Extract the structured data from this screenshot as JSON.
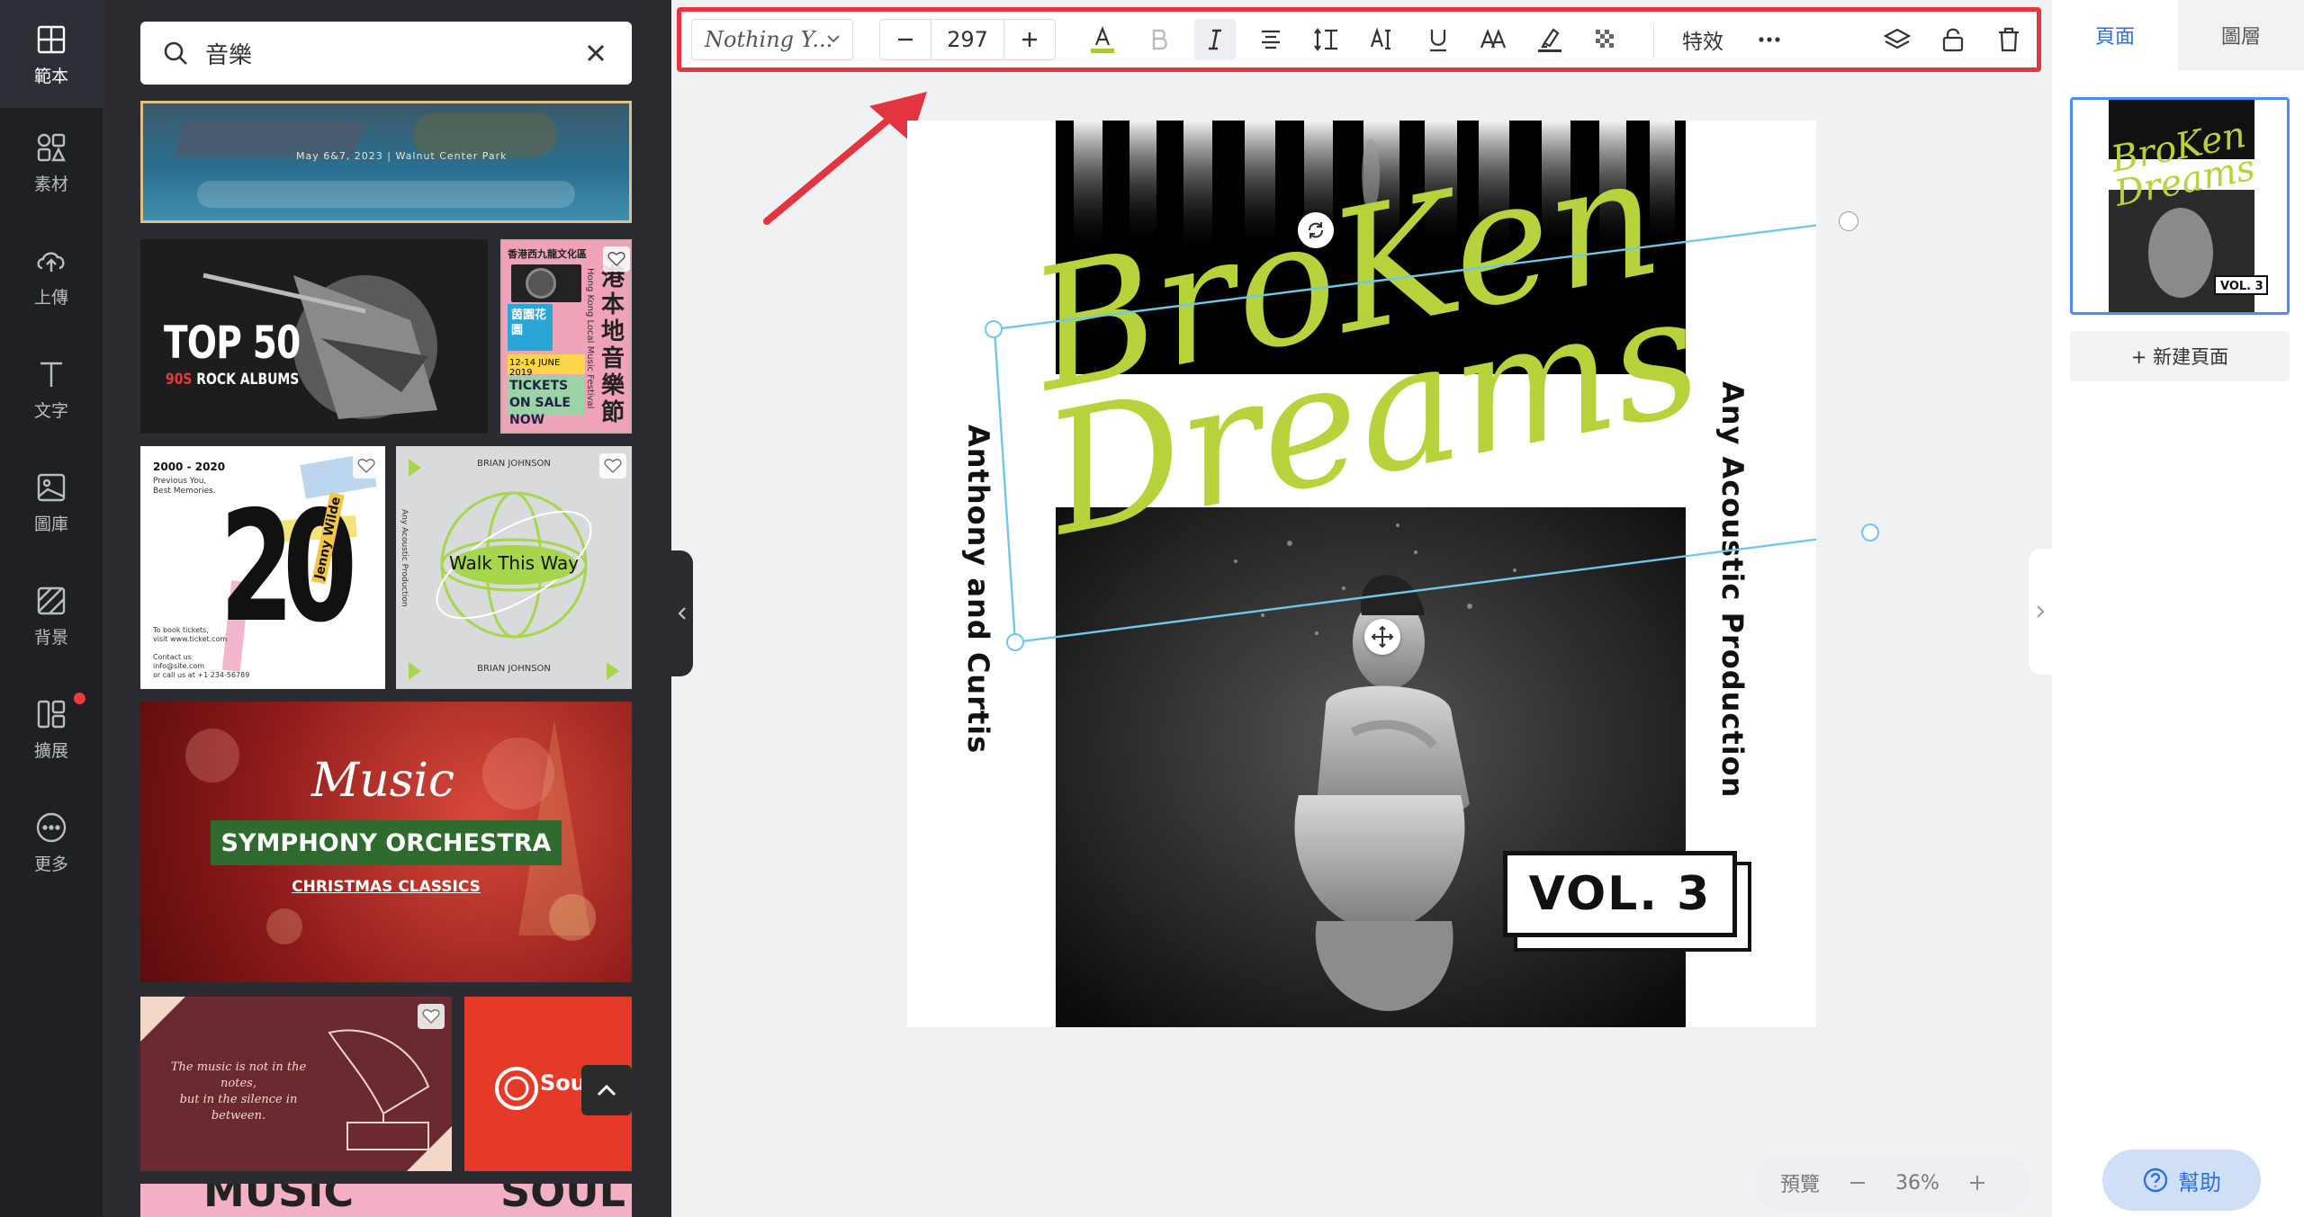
{
  "sidebar": {
    "items": [
      {
        "label": "範本",
        "icon": "template-icon"
      },
      {
        "label": "素材",
        "icon": "elements-icon"
      },
      {
        "label": "上傳",
        "icon": "upload-icon"
      },
      {
        "label": "文字",
        "icon": "text-icon"
      },
      {
        "label": "圖庫",
        "icon": "gallery-icon"
      },
      {
        "label": "背景",
        "icon": "background-icon"
      },
      {
        "label": "擴展",
        "icon": "extensions-icon"
      },
      {
        "label": "更多",
        "icon": "more-icon"
      }
    ]
  },
  "search": {
    "value": "音樂"
  },
  "templates": {
    "t0": {
      "caption": "May 6&7, 2023 | Walnut Center Park"
    },
    "t1": {
      "title": "TOP 50",
      "subtitle": "90S ROCK ALBUMS"
    },
    "t2": {
      "org": "香港西九龍文化區",
      "lines": [
        "港",
        "本",
        "地",
        "音",
        "樂",
        "節"
      ],
      "sub": "Hong Kong Local Music Festival",
      "badge": "茵園花園",
      "date": "12-14 JUNE 2019",
      "cta": "TICKETS ON SALE NOW"
    },
    "t3": {
      "years": "2000 - 2020",
      "l1": "Previous You,",
      "l2": "Best Memories.",
      "big": "20",
      "name": "Jenny Wilde"
    },
    "t4": {
      "top": "BRIAN JOHNSON",
      "title": "Walk This Way",
      "side": "Any Acoustic Production",
      "bottom": "BRIAN JOHNSON"
    },
    "t5": {
      "script": "Music",
      "title": "SYMPHONY ORCHESTRA",
      "sub": "CHRISTMAS CLASSICS"
    },
    "t6": {
      "l1": "The music is not in the notes,",
      "l2": "but in the silence in between."
    },
    "t7": {
      "brand": "Sound"
    },
    "t8": {
      "left": "MUSIC",
      "right": "SOUL"
    }
  },
  "toolbar": {
    "font": "Nothing Y...",
    "size": "297",
    "effects_label": "特效",
    "text_color": "#a9c93a"
  },
  "canvas": {
    "title_line1": "BroKen",
    "title_line2": "Dreams",
    "left_text": "Anthony and Curtis",
    "right_text": "Any Acoustic Production",
    "vol": "VOL. 3"
  },
  "zoom": {
    "preview_label": "預覽",
    "value": "36%"
  },
  "right_panel": {
    "tabs": [
      "頁面",
      "圖層"
    ],
    "new_page": "+ 新建頁面",
    "help": "幫助"
  },
  "colors": {
    "accent": "#2f6fe0",
    "toolbar_border": "#e3343f",
    "title_green": "#b6d33b"
  }
}
